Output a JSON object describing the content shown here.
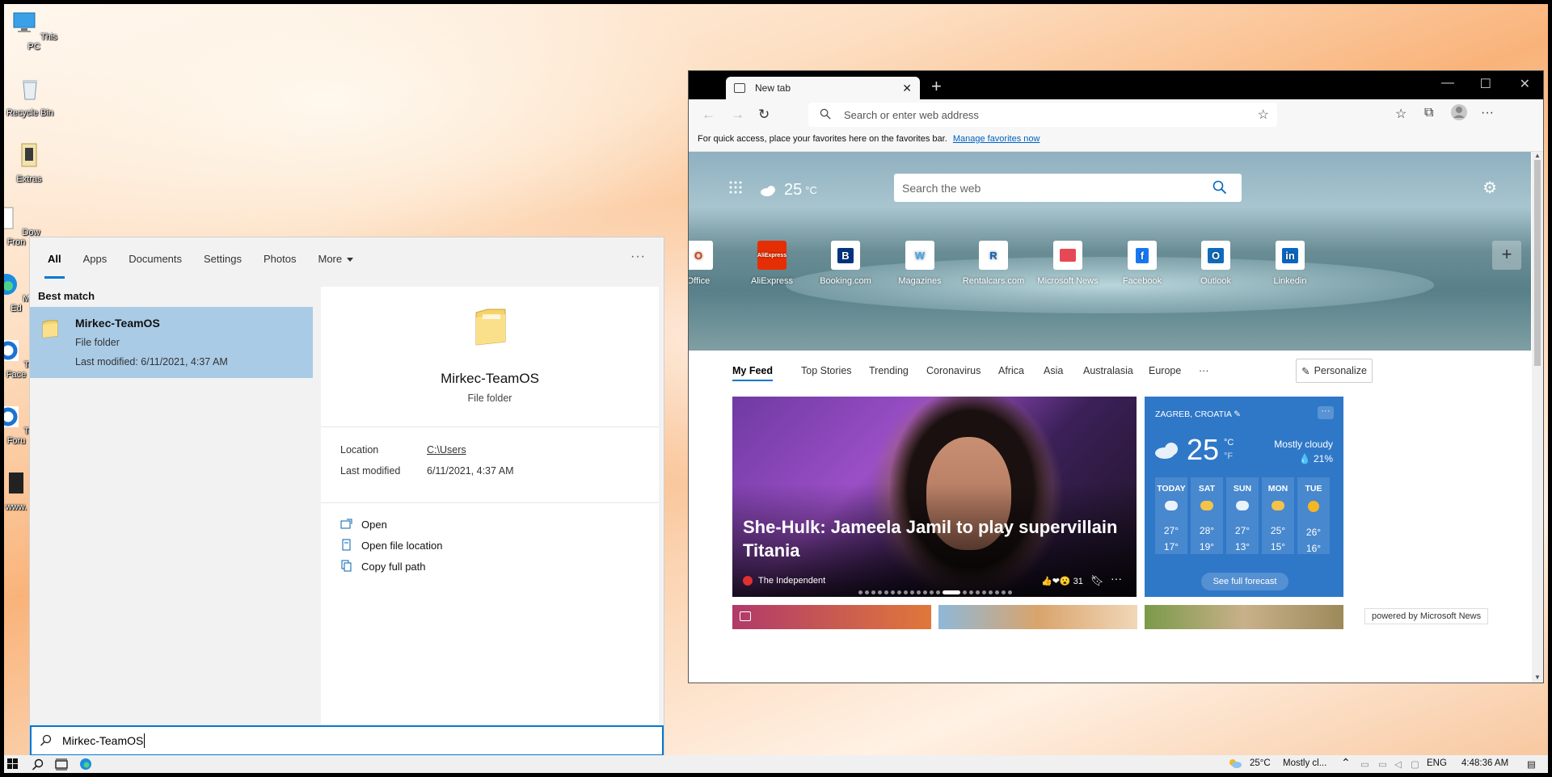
{
  "desktop": {
    "icons": [
      {
        "label": "This PC"
      },
      {
        "label": "Recycle Bin"
      },
      {
        "label": "Extras"
      },
      {
        "label": "Dow Fron"
      },
      {
        "label": "Micr Ed"
      },
      {
        "label": "Tea Face"
      },
      {
        "label": "Tea Foru"
      },
      {
        "label": "www."
      }
    ]
  },
  "search": {
    "tabs": [
      "All",
      "Apps",
      "Documents",
      "Settings",
      "Photos",
      "More"
    ],
    "active_tab": "All",
    "more_options": "···",
    "best_match_label": "Best match",
    "result": {
      "name": "Mirkec-TeamOS",
      "type": "File folder",
      "modified": "Last modified: 6/11/2021, 4:37 AM"
    },
    "detail": {
      "title": "Mirkec-TeamOS",
      "subtitle": "File folder",
      "location_key": "Location",
      "location_value": "C:\\Users",
      "modified_key": "Last modified",
      "modified_value": "6/11/2021, 4:37 AM",
      "actions": [
        "Open",
        "Open file location",
        "Copy full path"
      ]
    },
    "query": "Mirkec-TeamOS"
  },
  "edge": {
    "tab_title": "New tab",
    "tab_close": "✕",
    "new_tab": "+",
    "window_controls": [
      "—",
      "☐",
      "✕"
    ],
    "address_placeholder": "Search or enter web address",
    "favorites_bar_text": "For quick access, place your favorites here on the favorites bar.",
    "favorites_bar_link": "Manage favorites now",
    "weather_temp": "25",
    "weather_unit": "°C",
    "web_search_placeholder": "Search the web",
    "quick_links": [
      "Office",
      "AliExpress",
      "Booking.com",
      "Magazines",
      "Rentalcars.com",
      "Microsoft News",
      "Facebook",
      "Outlook",
      "Linkedin"
    ],
    "add_link": "+",
    "feed_tabs": [
      "My Feed",
      "Top Stories",
      "Trending",
      "Coronavirus",
      "Africa",
      "Asia",
      "Australasia",
      "Europe",
      "···"
    ],
    "personalize": "Personalize",
    "hero_headline": "She-Hulk: Jameela Jamil to play supervillain Titania",
    "hero_source": "The Independent",
    "hero_reactions": "31",
    "weather_card": {
      "location": "ZAGREB, CROATIA",
      "temp": "25",
      "unit_c": "°C",
      "unit_f": "°F",
      "condition": "Mostly cloudy",
      "precip": "💧 21%",
      "days": [
        {
          "day": "TODAY",
          "hi": "27°",
          "lo": "17°",
          "icon": "cloud"
        },
        {
          "day": "SAT",
          "hi": "28°",
          "lo": "19°",
          "icon": "partly-sunny"
        },
        {
          "day": "SUN",
          "hi": "27°",
          "lo": "13°",
          "icon": "cloud"
        },
        {
          "day": "MON",
          "hi": "25°",
          "lo": "15°",
          "icon": "partly-sunny"
        },
        {
          "day": "TUE",
          "hi": "26°",
          "lo": "16°",
          "icon": "sun"
        }
      ],
      "forecast_button": "See full forecast"
    },
    "powered_by": "powered by Microsoft News"
  },
  "taskbar": {
    "weather": "25°C",
    "weather_text": "Mostly cl...",
    "language": "ENG",
    "time": "4:48:36 AM"
  }
}
